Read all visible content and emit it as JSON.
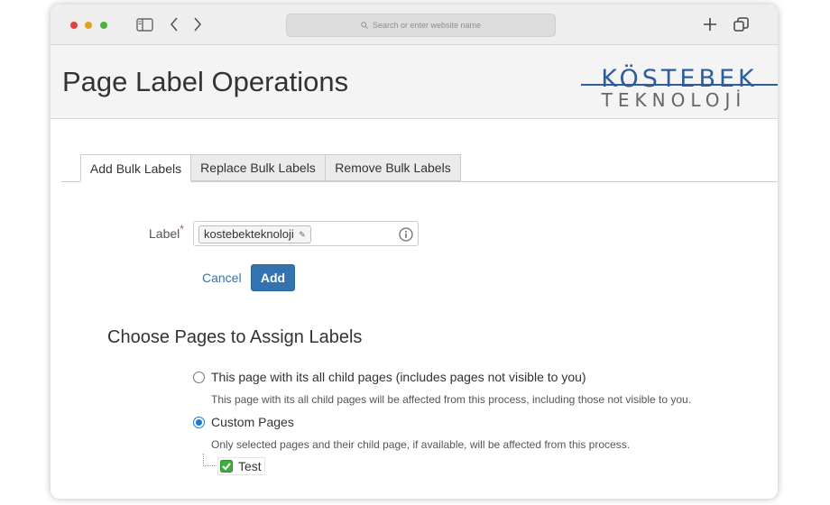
{
  "browser": {
    "url_placeholder": "Search or enter website name",
    "icons": [
      "sidebar-icon",
      "back-chevron-icon",
      "forward-chevron-icon",
      "search-icon",
      "new-tab-plus-icon",
      "tabs-overview-icon"
    ]
  },
  "header": {
    "title": "Page Label Operations",
    "logo_top": "KÖSTEBEK",
    "logo_bottom": "TEKNOLOJİ"
  },
  "tabs": [
    {
      "label": "Add Bulk Labels",
      "active": true
    },
    {
      "label": "Replace Bulk Labels",
      "active": false
    },
    {
      "label": "Remove Bulk Labels",
      "active": false
    }
  ],
  "form": {
    "label_text": "Label",
    "required_mark": "*",
    "label_value": "kostebekteknoloji",
    "cancel_label": "Cancel",
    "add_label": "Add"
  },
  "pages_section": {
    "title": "Choose Pages to Assign Labels",
    "options": [
      {
        "label": "This page with its all child pages (includes pages not visible to you)",
        "description": "This page with its all child pages will be affected from this process, including those not visible to you.",
        "selected": false
      },
      {
        "label": "Custom Pages",
        "description": "Only selected pages and their child page, if available, will be affected from this process.",
        "selected": true
      }
    ],
    "tree": [
      {
        "label": "Test",
        "checked": true
      }
    ]
  },
  "colors": {
    "accent": "#3572b0",
    "link": "#3572b0",
    "radio_selected": "#1e78d6",
    "required": "#d04437",
    "logo": "#2d5d9e",
    "checkbox": "#3fae3f"
  }
}
